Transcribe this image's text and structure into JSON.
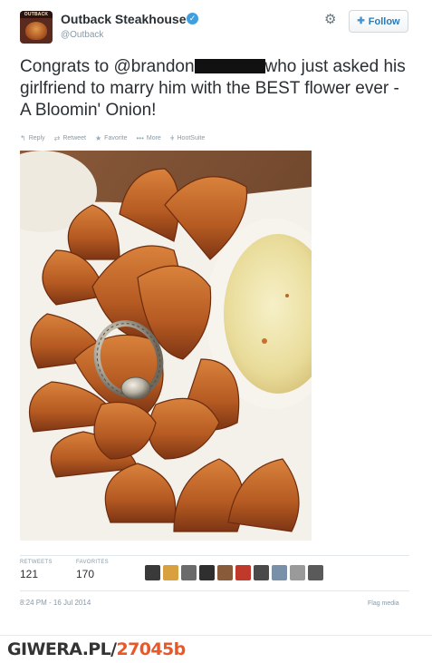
{
  "account": {
    "name": "Outback Steakhouse",
    "handle": "@Outback",
    "avatar_text": "OUTBACK",
    "verified_icon": "verified-badge-icon"
  },
  "header": {
    "follow_label": "Follow",
    "gear_icon": "gear-icon"
  },
  "tweet": {
    "text_before": "Congrats to @brandon",
    "text_after": "who just asked his girlfriend to marry him with the BEST flower ever - A Bloomin' Onion!"
  },
  "actions": [
    {
      "icon": "reply-icon",
      "label": "Reply"
    },
    {
      "icon": "retweet-icon",
      "label": "Retweet"
    },
    {
      "icon": "star-icon",
      "label": "Favorite"
    },
    {
      "icon": "more-icon",
      "label": "More"
    },
    {
      "icon": "hootsuite-icon",
      "label": "HootSuite"
    }
  ],
  "stats": {
    "retweets_label": "RETWEETS",
    "retweets": "121",
    "favorites_label": "FAVORITES",
    "favorites": "170"
  },
  "timestamp": "8:24 PM - 16 Jul 2014",
  "flag_media": "Flag media",
  "watermark": {
    "site": "GIWERA.PL/",
    "id": "27045b"
  },
  "colors": {
    "link": "#2b7bb9",
    "verified": "#3f9fdf",
    "watermark_accent": "#e8582a"
  }
}
